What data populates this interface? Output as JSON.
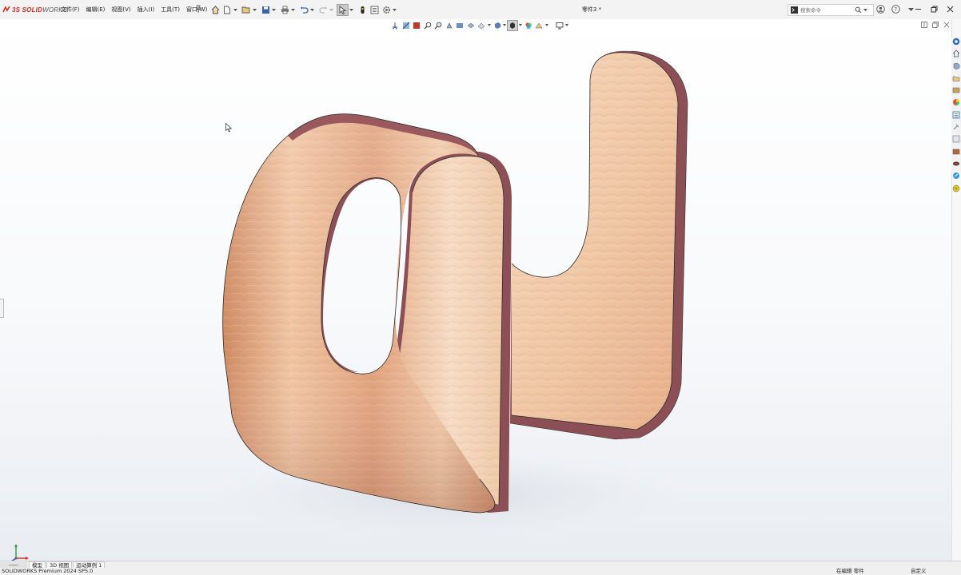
{
  "app": {
    "logo_text_red": "3S SOLID",
    "logo_text_gray": "WORKS",
    "document_title": "零件3 *"
  },
  "menu": {
    "items": [
      "文件(F)",
      "编辑(E)",
      "视图(V)",
      "插入(I)",
      "工具(T)",
      "窗口(W)"
    ]
  },
  "search": {
    "placeholder": "搜索命令"
  },
  "bottom_tabs": {
    "items": [
      "模型",
      "3D 视图",
      "运动算例 1"
    ],
    "active_index": 0
  },
  "status": {
    "version": "SOLIDWORKS Premium 2024 SP5.0",
    "mode": "在编辑 零件",
    "units": "自定义"
  },
  "colors": {
    "copper_light": "#f3d3b8",
    "copper_mid": "#d8946e",
    "copper_edge": "#8a4a4e",
    "solidworks_red": "#d52b1e"
  },
  "icons": {
    "quick_access": [
      "home-icon",
      "new-document-icon",
      "open-icon",
      "save-icon",
      "print-icon",
      "undo-icon",
      "redo-icon",
      "select-icon",
      "rebuild-icon",
      "file-properties-icon",
      "options-icon"
    ],
    "heads_up": [
      "view-orientation-icon",
      "section-view-icon",
      "display-style-icon",
      "zoom-to-fit-icon",
      "zoom-area-icon",
      "previous-view-icon",
      "dynamic-annotation-icon",
      "hide-show-icon",
      "edit-appearance-icon",
      "apply-scene-icon",
      "view-settings-icon",
      "monitor-icon"
    ],
    "task_pane": [
      "solidworks-resources-icon",
      "design-library-icon",
      "file-explorer-icon",
      "view-palette-icon",
      "appearances-icon",
      "custom-properties-icon",
      "3dexperience-icon",
      "toolbox-icon",
      "forum-icon",
      "photo-icon",
      "help-icon",
      "solidworks-forum-icon",
      "marketplace-icon"
    ]
  }
}
